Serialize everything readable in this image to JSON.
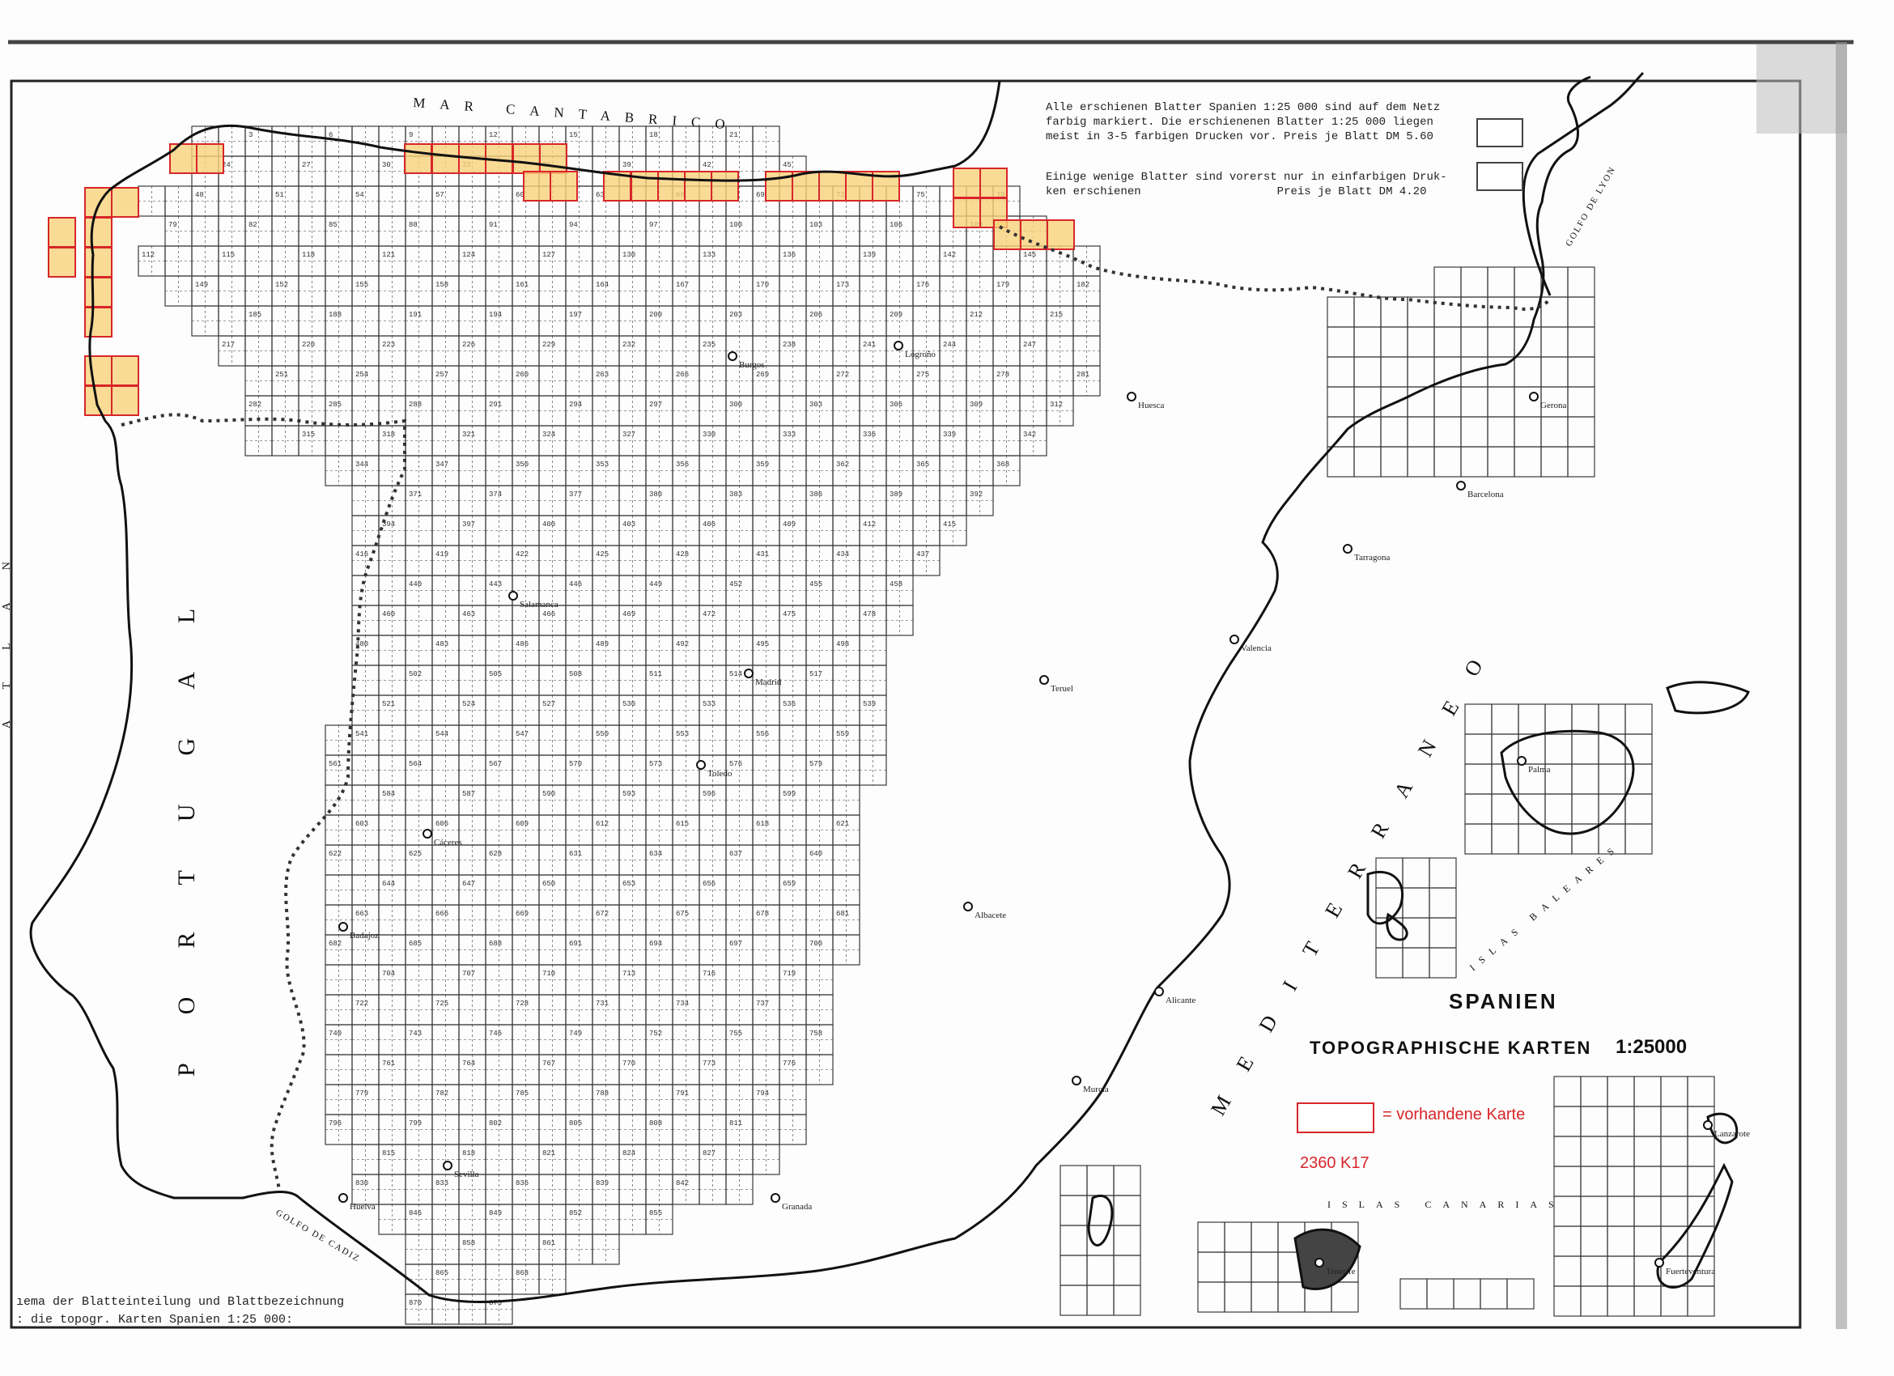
{
  "map": {
    "sea_labels": {
      "cantabrico": "MAR CANTABRICO",
      "mediterraneo": "MEDITERRANEO",
      "lyon": "GOLFO DE LYON",
      "cadiz": "GOLFO DE CADIZ",
      "baleares": "ISLAS BALEARES",
      "canarias": "ISLAS CANARIAS"
    },
    "country_labels": {
      "portugal": "PORTUGAL",
      "atlantic_fragment": "ATLAN"
    },
    "cities": [
      "Burgos",
      "Logroño",
      "Huesca",
      "Salamanca",
      "Madrid",
      "Teruel",
      "Tarragona",
      "Barcelona",
      "Gerona",
      "Cáceres",
      "Toledo",
      "Badajoz",
      "Albacete",
      "Alicante",
      "Murcia",
      "Sevilla",
      "Huelva",
      "Granada",
      "Palma",
      "Fuerteventura",
      "Lanzarote",
      "Tenerife",
      "Valencia"
    ],
    "colors": {
      "grid_line": "#3a3a3a",
      "coast_line": "#111111",
      "border_line": "#333333",
      "highlight_fill": "#f9d27a",
      "highlight_border": "#d8262a",
      "legend_red": "#d8262a"
    }
  },
  "legend": {
    "note_1": "Alle erschienen Blatter Spanien 1:25 000 sind auf dem Netz\nfarbig markiert. Die erschienenen Blatter 1:25 000 liegen\nmeist in 3-5 farbigen Drucken vor. Preis je Blatt DM 5.60",
    "note_2": "Einige wenige Blatter sind vorerst nur in einfarbigen Druk-\nken erschienen                    Preis je Blatt DM 4.20",
    "available_label": "= vorhandene Karte",
    "reference_code": "2360 K17"
  },
  "title": {
    "country": "SPANIEN",
    "subtitle": "TOPOGRAPHISCHE KARTEN",
    "scale": "1:25000"
  },
  "caption": {
    "line_1": "ıema der Blatteinteilung und Blattbezeichnung",
    "line_2": ": die topogr. Karten Spanien 1:25 000:"
  }
}
